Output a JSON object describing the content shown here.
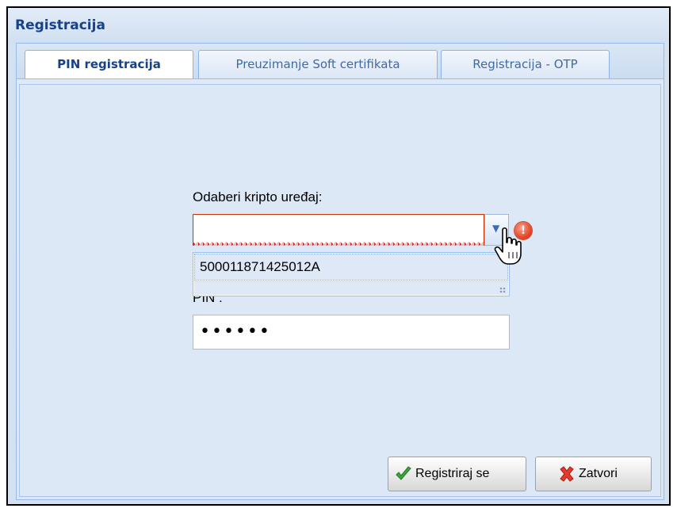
{
  "window": {
    "title": "Registracija"
  },
  "tabs": [
    {
      "label": "PIN registracija",
      "active": true
    },
    {
      "label": "Preuzimanje Soft certifikata",
      "active": false
    },
    {
      "label": "Registracija - OTP",
      "active": false
    }
  ],
  "form": {
    "device_label": "Odaberi kripto uređaj:",
    "device_value": "",
    "device_options": [
      "500011871425012A"
    ],
    "pin_label": "PIN :",
    "pin_value": "••••••"
  },
  "buttons": {
    "register": "Registriraj se",
    "close": "Zatvori"
  },
  "colors": {
    "accent": "#15428b",
    "error": "#cc3300",
    "panel": "#dde8f6"
  },
  "icons": {
    "trigger": "chevron-down-icon",
    "error": "error-icon",
    "register": "checkmark-icon",
    "close": "red-x-icon",
    "cursor": "hand-pointer-icon"
  }
}
